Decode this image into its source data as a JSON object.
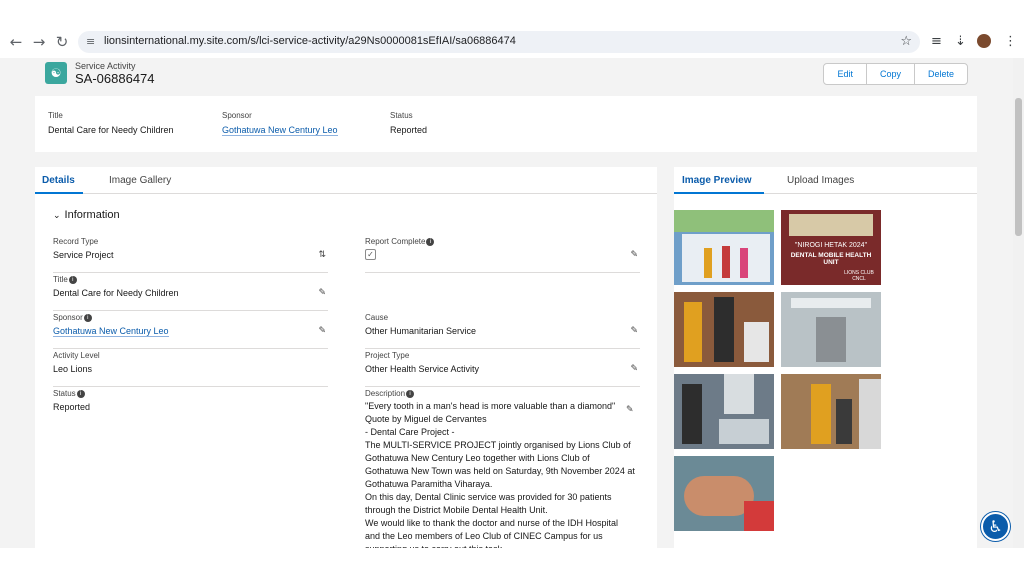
{
  "browser": {
    "url": "lionsinternational.my.site.com/s/lci-service-activity/a29Ns0000081sEfIAI/sa06886474",
    "icons": [
      "back-arrow-icon",
      "forward-arrow-icon",
      "reload-icon",
      "site-info-icon",
      "bookmark-star-icon",
      "media-icon",
      "download-icon",
      "profile-avatar",
      "kebab-menu-icon"
    ]
  },
  "record": {
    "type_label": "Service Activity",
    "name": "SA-06886474",
    "actions": {
      "edit": "Edit",
      "copy": "Copy",
      "delete": "Delete"
    }
  },
  "highlights": {
    "title_label": "Title",
    "title_value": "Dental Care for Needy Children",
    "sponsor_label": "Sponsor",
    "sponsor_value": "Gothatuwa New Century Leo",
    "status_label": "Status",
    "status_value": "Reported"
  },
  "left_tabs": {
    "details": "Details",
    "gallery": "Image Gallery"
  },
  "section": {
    "title": "Information"
  },
  "fields": {
    "record_type": {
      "label": "Record Type",
      "value": "Service Project"
    },
    "title": {
      "label": "Title",
      "value": "Dental Care for Needy Children"
    },
    "sponsor": {
      "label": "Sponsor",
      "value": "Gothatuwa New Century Leo"
    },
    "activity_level": {
      "label": "Activity Level",
      "value": "Leo Lions"
    },
    "status": {
      "label": "Status",
      "value": "Reported"
    },
    "report_complete": {
      "label": "Report Complete",
      "checked": true
    },
    "cause": {
      "label": "Cause",
      "value": "Other Humanitarian Service"
    },
    "project_type": {
      "label": "Project Type",
      "value": "Other Health Service Activity"
    },
    "description": {
      "label": "Description",
      "lines": [
        "\"Every tooth in a man's head is more valuable than a diamond\"",
        "Quote by Miguel de Cervantes",
        "- Dental Care Project -",
        "The MULTI-SERVICE PROJECT jointly organised by Lions Club of Gothatuwa New Century Leo together with Lions Club of Gothatuwa New Town was held on Saturday, 9th November 2024 at Gothatuwa Paramitha Viharaya.",
        "On this day, Dental Clinic service was provided for 30 patients through the District Mobile Dental Health Unit.",
        "We would like to thank the doctor and nurse of the IDH Hospital and the Leo members of Leo Club of CINEC Campus for us supporting us to carry out this task."
      ]
    }
  },
  "right_tabs": {
    "preview": "Image Preview",
    "upload": "Upload Images"
  },
  "images": [
    {
      "kind": "mobile-unit-photo",
      "bg": "#6f9fc9"
    },
    {
      "kind": "banner-photo",
      "bg": "#7a2a2a",
      "caption_line1": "\"NIROGI HETAK 2024\"",
      "caption_line2": "DENTAL MOBILE HEALTH UNIT",
      "sub": "LIONS CLUB CNCL"
    },
    {
      "kind": "clinic-photo",
      "bg": "#8a5a3c"
    },
    {
      "kind": "clinic-photo",
      "bg": "#b9c2c6"
    },
    {
      "kind": "clinic-photo",
      "bg": "#6d7b88"
    },
    {
      "kind": "clinic-photo",
      "bg": "#a07b56"
    },
    {
      "kind": "patient-photo",
      "bg": "#6b8a96"
    }
  ],
  "accessibility": {
    "icon": "accessibility-icon"
  }
}
